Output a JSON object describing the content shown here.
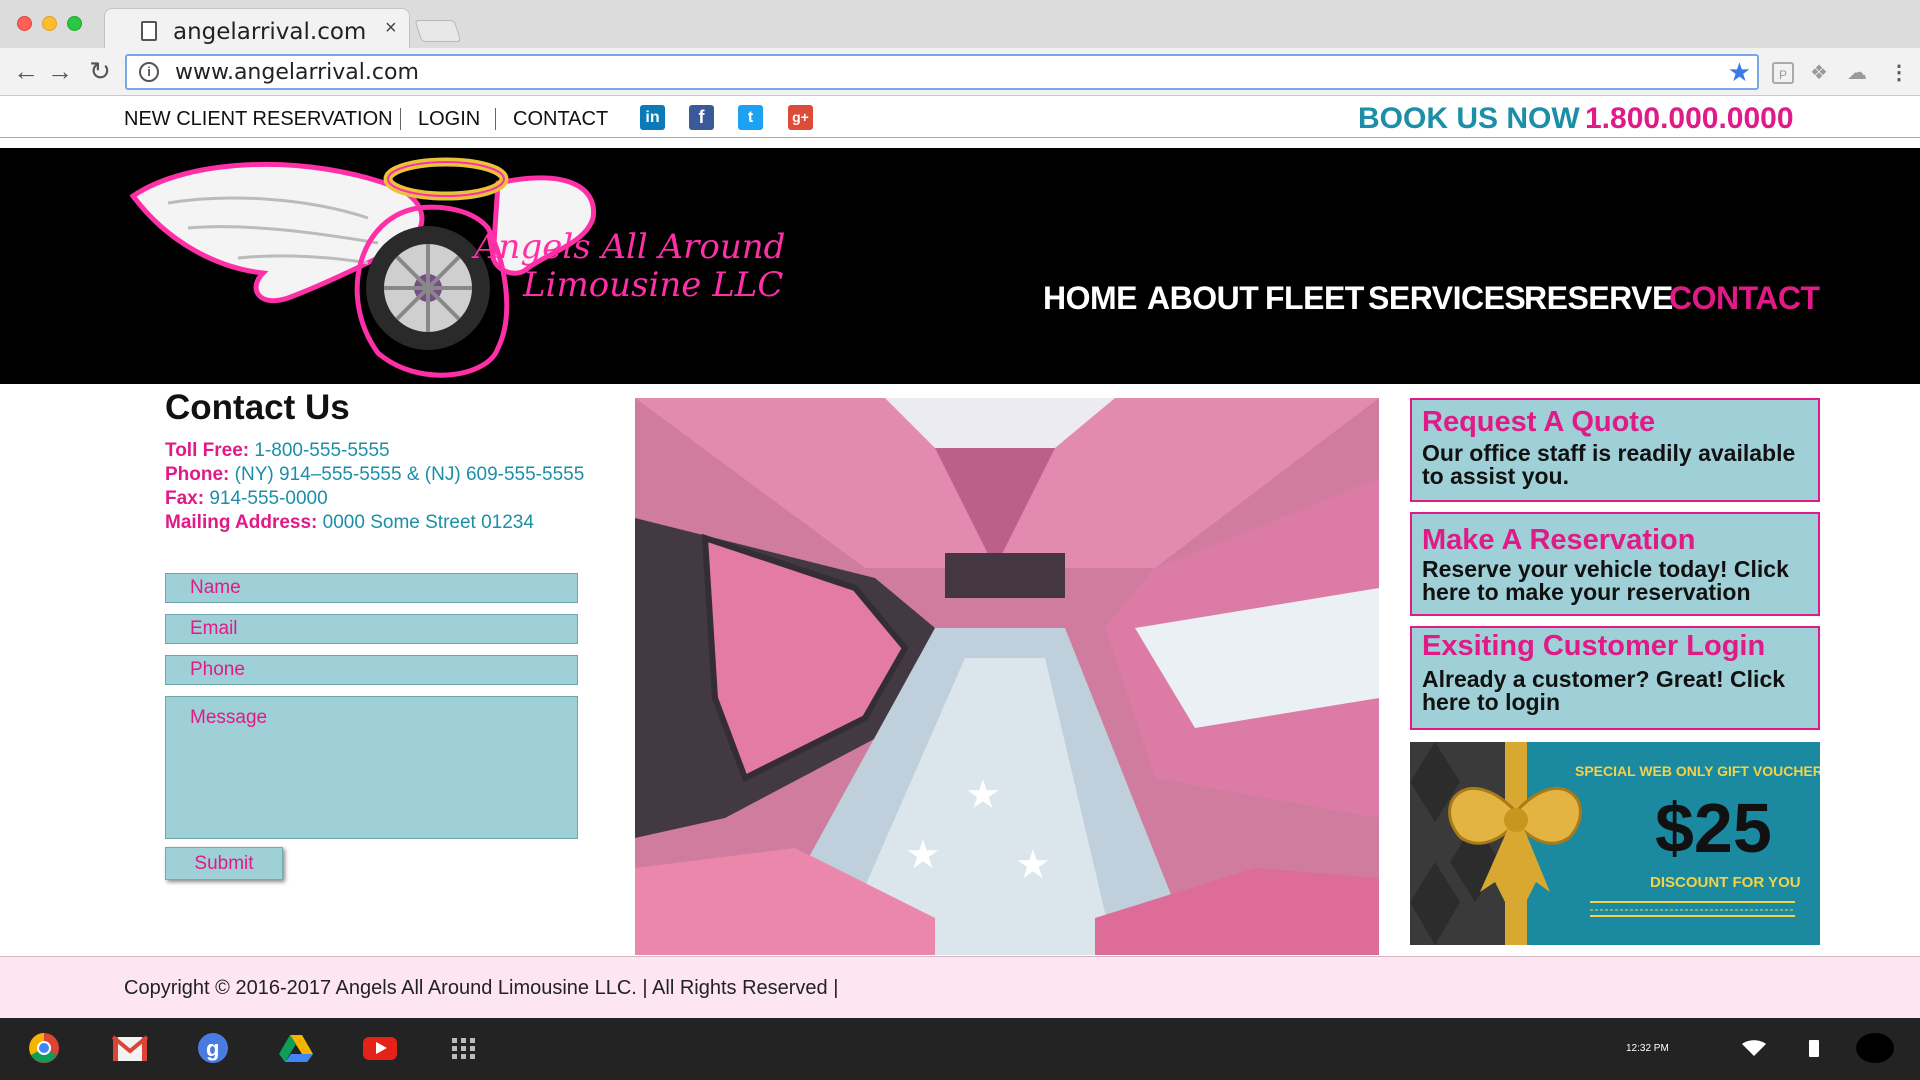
{
  "browser": {
    "tab_title": "angelarrival.com",
    "tab_close": "×",
    "url": "www.angelarrival.com",
    "back": "←",
    "forward": "→",
    "reload": "↻",
    "info": "i",
    "star": "★",
    "menu": "⋮"
  },
  "topbar": {
    "new_client": "NEW CLIENT RESERVATION",
    "login": "LOGIN",
    "contact": "CONTACT",
    "social": {
      "linkedin": "in",
      "facebook": "f",
      "twitter": "t",
      "gplus": "g+"
    },
    "book_us": "BOOK US NOW",
    "phone": "1.800.000.0000"
  },
  "header": {
    "logo_line1": "Angels All Around",
    "logo_line2": "Limousine LLC",
    "nav": [
      "HOME",
      "ABOUT",
      "FLEET",
      "SERVICES",
      "RESERVE",
      "CONTACT"
    ]
  },
  "contact": {
    "title": "Contact Us",
    "toll_free_label": "Toll Free:",
    "toll_free": " 1-800-555-5555",
    "phone_label": "Phone:",
    "phone": " (NY) 914–555-5555  &  (NJ) 609-555-5555",
    "fax_label": "Fax:",
    "fax": " 914-555-0000",
    "mail_label": "Mailing Address:",
    "mail": " 0000 Some Street 01234",
    "form": {
      "name": "Name",
      "email": "Email",
      "phone": "Phone",
      "message": "Message",
      "submit": "Submit"
    }
  },
  "sidebar": {
    "quote_title": "Request A Quote",
    "quote_body": "Our office staff is readily available to assist you.",
    "reserve_title": "Make A Reservation",
    "reserve_body": "Reserve your vehicle today! Click here to make your reservation",
    "login_title": "Exsiting Customer Login",
    "login_body": "Already a customer? Great! Click here to login",
    "voucher": {
      "headline": "SPECIAL WEB ONLY GIFT VOUCHER",
      "amount": "$25",
      "sub": "DISCOUNT FOR YOU"
    }
  },
  "footer": {
    "copyright": "Copyright © 2016-2017 Angels All Around Limousine LLC. | All Rights Reserved |"
  },
  "shelf": {
    "time": "12:32 PM",
    "apps": [
      "chrome-icon",
      "gmail-icon",
      "google-icon",
      "drive-icon",
      "youtube-icon",
      "apps-grid-icon"
    ]
  },
  "colors": {
    "accent_pink": "#e01a86",
    "accent_teal": "#1c8ea6",
    "field_bg": "#9fd0d8",
    "footer_bg": "#fde6f2"
  }
}
